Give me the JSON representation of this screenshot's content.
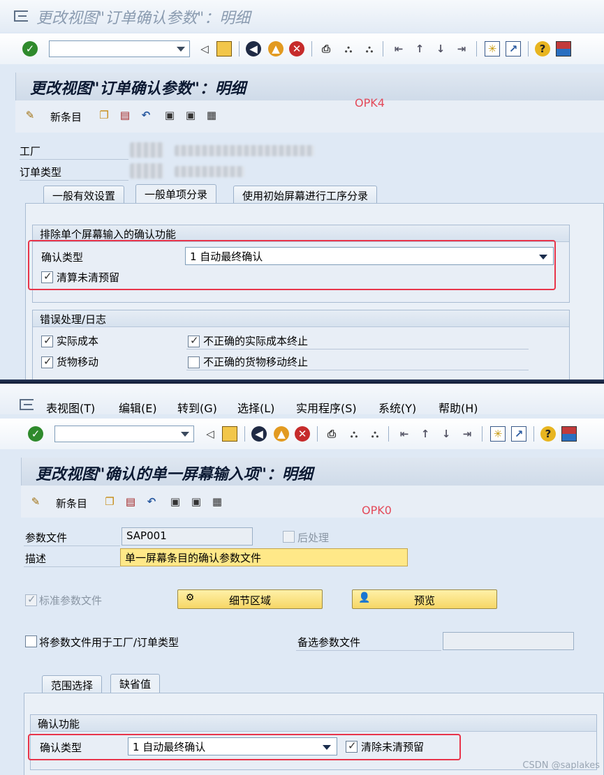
{
  "top": {
    "title": "更改视图\"订单确认参数\"：明细",
    "panel_title": "更改视图\"订单确认参数\"：明细",
    "new_entries": "新条目",
    "annotation": "OPK4",
    "plant_label": "工厂",
    "order_type_label": "订单类型",
    "tabs": [
      "一般有效设置",
      "一般单项分录",
      "使用初始屏幕进行工序分录"
    ],
    "group1_title": "排除单个屏幕输入的确认功能",
    "confirm_type_label": "确认类型",
    "confirm_type_value": "1 自动最终确认",
    "clear_reservation_label": "清算未清预留",
    "group2_title": "错误处理/日志",
    "actual_cost_label": "实际成本",
    "wrong_actual_cost_label": "不正确的实际成本终止",
    "goods_mvt_label": "货物移动",
    "wrong_goods_mvt_label": "不正确的货物移动终止"
  },
  "bottom": {
    "menu": [
      "表视图(T)",
      "编辑(E)",
      "转到(G)",
      "选择(L)",
      "实用程序(S)",
      "系统(Y)",
      "帮助(H)"
    ],
    "panel_title": "更改视图\"确认的单一屏幕输入项\"：明细",
    "new_entries": "新条目",
    "annotation": "OPK0",
    "profile_label": "参数文件",
    "profile_value": "SAP001",
    "post_process_label": "后处理",
    "desc_label": "描述",
    "desc_value": "单一屏幕条目的确认参数文件",
    "std_profile_label": "标准参数文件",
    "detail_area_btn": "细节区域",
    "preview_btn": "预览",
    "use_for_plant_label": "将参数文件用于工厂/订单类型",
    "alt_profile_label": "备选参数文件",
    "tabs": [
      "范围选择",
      "缺省值"
    ],
    "group_title": "确认功能",
    "confirm_type_label": "确认类型",
    "confirm_type_value": "1 自动最终确认",
    "clear_reservation_label": "清除未清预留"
  },
  "footer": "CSDN @saplakes",
  "colors": {
    "annotation_red": "#e8344a",
    "sap_bg": "#dfe9f5",
    "button_yellow": "#f6d766"
  }
}
